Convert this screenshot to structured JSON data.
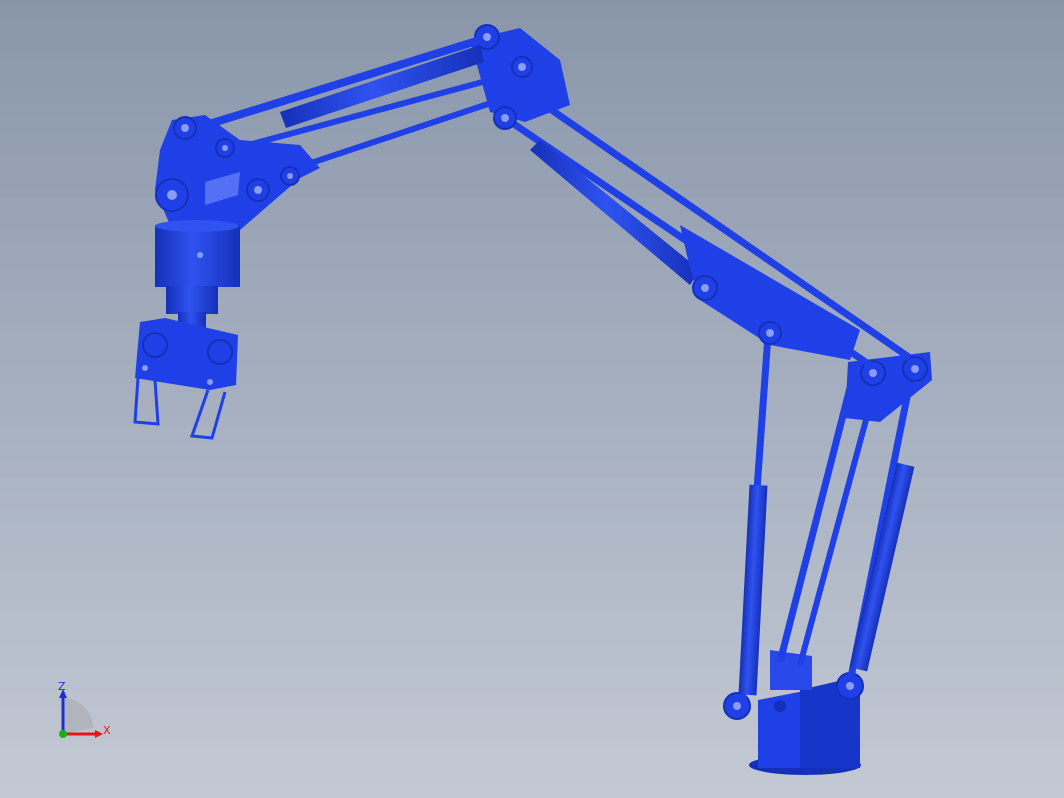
{
  "model": {
    "name": "robot-arm",
    "color": "#1f40e6",
    "color_dark": "#1530b8",
    "color_light": "#3b5cf5"
  },
  "triad": {
    "z_label": "Z",
    "x_label": "X",
    "z_color": "#1f2fd0",
    "x_color": "#e01818",
    "y_color": "#18b018"
  }
}
